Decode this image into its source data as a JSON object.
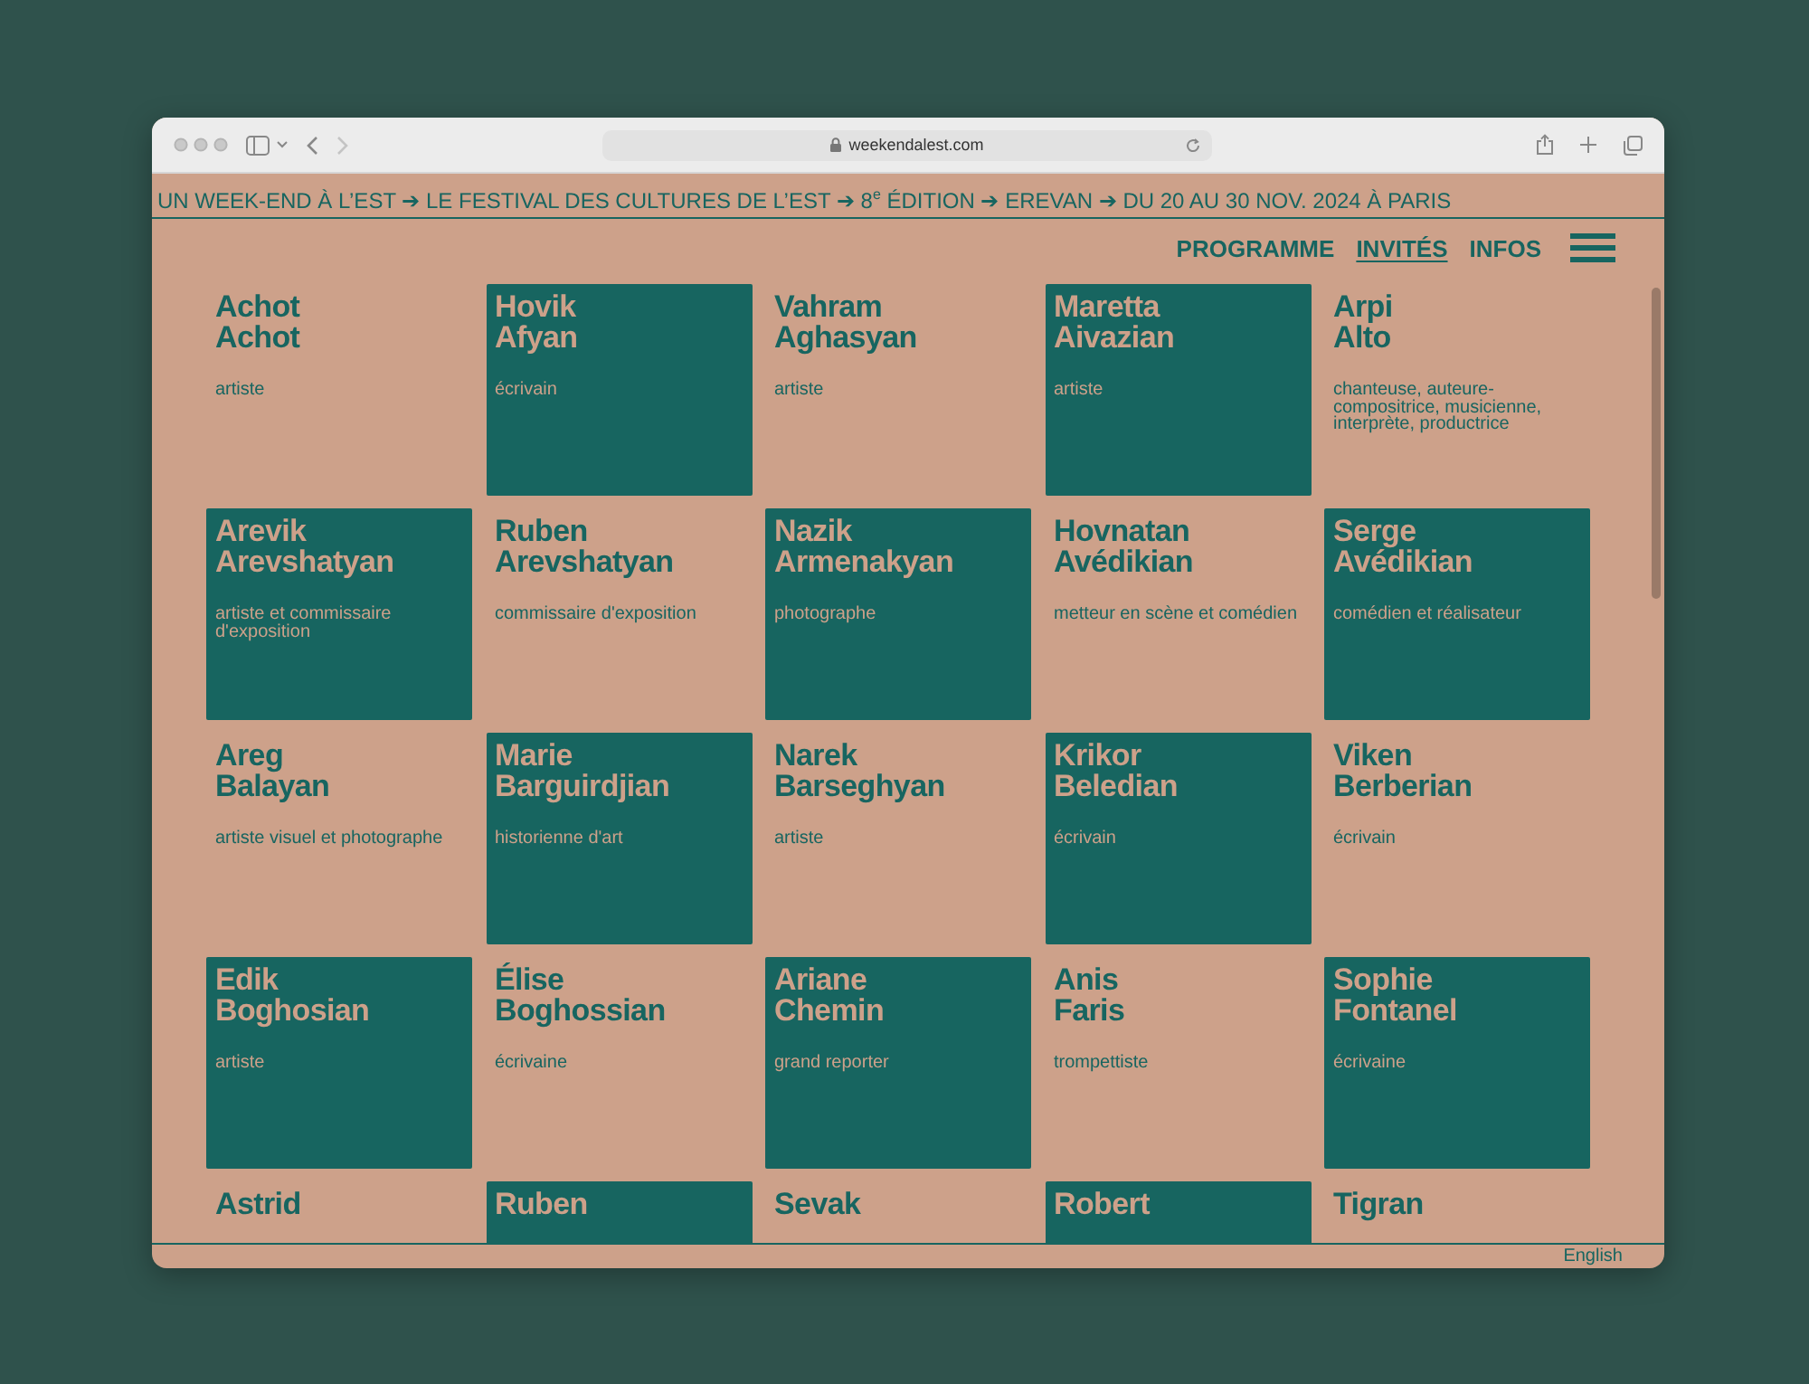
{
  "browser": {
    "url": "weekendalest.com"
  },
  "banner": "UN WEEK-END À L’EST ➔  LE FESTIVAL DES CULTURES DE L’EST ➔ 8$^{e}$ ÉDITION  ➔ EREVAN ➔ DU 20 AU 30 NOV. 2024 À PARIS",
  "nav": [
    {
      "label": "PROGRAMME",
      "selected": false
    },
    {
      "label": "INVITÉS",
      "selected": true
    },
    {
      "label": "INFOS",
      "selected": false
    }
  ],
  "guests": [
    {
      "first": "Achot",
      "last": "Achot",
      "role": "artiste",
      "highlighted": false
    },
    {
      "first": "Hovik",
      "last": "Afyan",
      "role": "écrivain",
      "highlighted": true
    },
    {
      "first": "Vahram",
      "last": "Aghasyan",
      "role": "artiste",
      "highlighted": false
    },
    {
      "first": "Maretta",
      "last": "Aivazian",
      "role": "artiste",
      "highlighted": true
    },
    {
      "first": "Arpi",
      "last": "Alto",
      "role": "chanteuse, auteure-compositrice, musicienne, interprète, productrice",
      "highlighted": false
    },
    {
      "first": "Arevik",
      "last": "Arevshatyan",
      "role": "artiste et commissaire d'exposition",
      "highlighted": true
    },
    {
      "first": "Ruben",
      "last": "Arevshatyan",
      "role": "commissaire d'exposition",
      "highlighted": false
    },
    {
      "first": "Nazik",
      "last": "Armenakyan",
      "role": "photographe",
      "highlighted": true
    },
    {
      "first": "Hovnatan",
      "last": "Avédikian",
      "role": "metteur en scène et comédien",
      "highlighted": false
    },
    {
      "first": "Serge",
      "last": "Avédikian",
      "role": "comédien et réalisateur",
      "highlighted": true
    },
    {
      "first": "Areg",
      "last": "Balayan",
      "role": "artiste visuel et photographe",
      "highlighted": false
    },
    {
      "first": "Marie",
      "last": "Barguirdjian",
      "role": "historienne d'art",
      "highlighted": true
    },
    {
      "first": "Narek",
      "last": "Barseghyan",
      "role": "artiste",
      "highlighted": false
    },
    {
      "first": "Krikor",
      "last": "Beledian",
      "role": "écrivain",
      "highlighted": true
    },
    {
      "first": "Viken",
      "last": "Berberian",
      "role": "écrivain",
      "highlighted": false
    },
    {
      "first": "Edik",
      "last": "Boghosian",
      "role": "artiste",
      "highlighted": true
    },
    {
      "first": "Élise",
      "last": "Boghossian",
      "role": "écrivaine",
      "highlighted": false
    },
    {
      "first": "Ariane",
      "last": "Chemin",
      "role": "grand reporter",
      "highlighted": true
    },
    {
      "first": "Anis",
      "last": "Faris",
      "role": "trompettiste",
      "highlighted": false
    },
    {
      "first": "Sophie",
      "last": "Fontanel",
      "role": "écrivaine",
      "highlighted": true
    },
    {
      "first": "Astrid",
      "highlighted": false
    },
    {
      "first": "Ruben",
      "highlighted": true
    },
    {
      "first": "Sevak",
      "highlighted": false
    },
    {
      "first": "Robert",
      "highlighted": true
    },
    {
      "first": "Tigran",
      "highlighted": false
    }
  ],
  "footer": {
    "language": "English"
  }
}
